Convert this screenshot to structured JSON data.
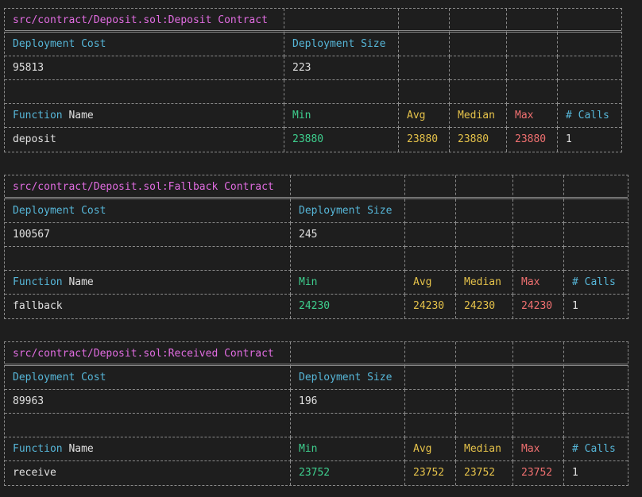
{
  "reports": [
    {
      "title": "src/contract/Deposit.sol:Deposit Contract",
      "deployment_cost_label": "Deployment Cost",
      "deployment_size_label": "Deployment Size",
      "deployment_cost": "95813",
      "deployment_size": "223",
      "headers": {
        "function_label": "Function",
        "name_label": "Name",
        "min": "Min",
        "avg": "Avg",
        "median": "Median",
        "max": "Max",
        "calls": "# Calls"
      },
      "function": {
        "name": "deposit",
        "min": "23880",
        "avg": "23880",
        "median": "23880",
        "max": "23880",
        "calls": "1"
      }
    },
    {
      "title": "src/contract/Deposit.sol:Fallback Contract",
      "deployment_cost_label": "Deployment Cost",
      "deployment_size_label": "Deployment Size",
      "deployment_cost": "100567",
      "deployment_size": "245",
      "headers": {
        "function_label": "Function",
        "name_label": "Name",
        "min": "Min",
        "avg": "Avg",
        "median": "Median",
        "max": "Max",
        "calls": "# Calls"
      },
      "function": {
        "name": "fallback",
        "min": "24230",
        "avg": "24230",
        "median": "24230",
        "max": "24230",
        "calls": "1"
      }
    },
    {
      "title": "src/contract/Deposit.sol:Received Contract",
      "deployment_cost_label": "Deployment Cost",
      "deployment_size_label": "Deployment Size",
      "deployment_cost": "89963",
      "deployment_size": "196",
      "headers": {
        "function_label": "Function",
        "name_label": "Name",
        "min": "Min",
        "avg": "Avg",
        "median": "Median",
        "max": "Max",
        "calls": "# Calls"
      },
      "function": {
        "name": "receive",
        "min": "23752",
        "avg": "23752",
        "median": "23752",
        "max": "23752",
        "calls": "1"
      }
    }
  ],
  "colors": {
    "title": "#e06ce0",
    "label": "#56b6d8",
    "min": "#3ecf8e",
    "avg": "#e5c24a",
    "median": "#e5c24a",
    "max": "#f07070",
    "background": "#1e1e1e"
  }
}
